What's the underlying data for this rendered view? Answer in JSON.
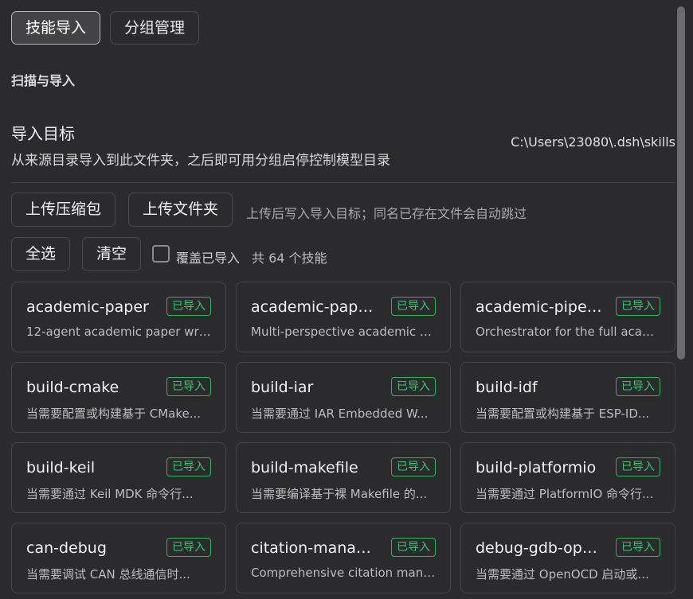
{
  "tabs": [
    {
      "label": "技能导入",
      "active": true
    },
    {
      "label": "分组管理",
      "active": false
    }
  ],
  "section_title": "扫描与导入",
  "target": {
    "title": "导入目标",
    "description": "从来源目录导入到此文件夹，之后即可用分组启停控制模型目录",
    "path": "C:\\Users\\23080\\.dsh\\skills"
  },
  "actions": {
    "upload_zip": "上传压缩包",
    "upload_folder": "上传文件夹",
    "hint": "上传后写入导入目标；同名已存在文件会自动跳过",
    "select_all": "全选",
    "clear": "清空",
    "overwrite_label": "覆盖已导入",
    "overwrite_checked": false,
    "total_label": "共 64 个技能"
  },
  "colors": {
    "badge": "#3cc56f",
    "background": "#2b2b2d"
  },
  "skills": [
    {
      "name": "academic-paper",
      "badge": "已导入",
      "desc": "12-agent academic paper writ..."
    },
    {
      "name": "academic-paper-...",
      "badge": "已导入",
      "desc": "Multi-perspective academic p..."
    },
    {
      "name": "academic-pipeline",
      "badge": "已导入",
      "desc": "Orchestrator for the full acade..."
    },
    {
      "name": "build-cmake",
      "badge": "已导入",
      "desc": "当需要配置或构建基于 CMake..."
    },
    {
      "name": "build-iar",
      "badge": "已导入",
      "desc": "当需要通过 IAR Embedded W..."
    },
    {
      "name": "build-idf",
      "badge": "已导入",
      "desc": "当需要配置或构建基于 ESP-ID..."
    },
    {
      "name": "build-keil",
      "badge": "已导入",
      "desc": "当需要通过 Keil MDK 命令行..."
    },
    {
      "name": "build-makefile",
      "badge": "已导入",
      "desc": "当需要编译基于裸 Makefile 的..."
    },
    {
      "name": "build-platformio",
      "badge": "已导入",
      "desc": "当需要通过 PlatformIO 命令行..."
    },
    {
      "name": "can-debug",
      "badge": "已导入",
      "desc": "当需要调试 CAN 总线通信时..."
    },
    {
      "name": "citation-manage...",
      "badge": "已导入",
      "desc": "Comprehensive citation mana..."
    },
    {
      "name": "debug-gdb-ope...",
      "badge": "已导入",
      "desc": "当需要通过 OpenOCD 启动或..."
    }
  ]
}
